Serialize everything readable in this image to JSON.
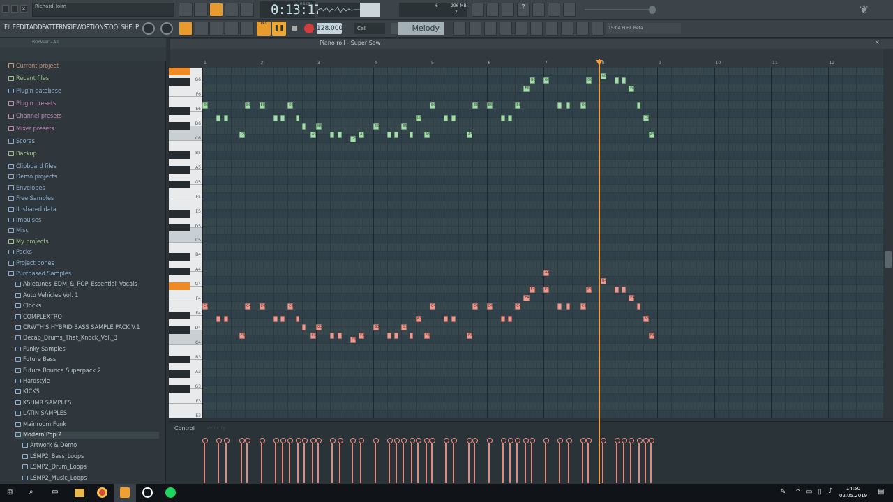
{
  "window": {
    "user": "RichardHolm"
  },
  "transport": {
    "time": "0:13:17",
    "time_label": "M:S:CS",
    "memory": "296 MB",
    "mem_small": "6",
    "voices": "2"
  },
  "menu": [
    "FILE",
    "EDIT",
    "ADD",
    "PATTERNS",
    "VIEW",
    "OPTIONS",
    "TOOLS",
    "HELP"
  ],
  "toolbar": {
    "tempo": "128.000",
    "snap": "Cell",
    "pattern": "Melody",
    "pat_label": "PAT",
    "hint_time": "15:04",
    "hint_text": "FLEX Beta"
  },
  "browser": {
    "header": "Browser - All",
    "items": [
      {
        "label": "Current project",
        "color": "#c69a7a",
        "indent": 0
      },
      {
        "label": "Recent files",
        "color": "#9fc38a",
        "indent": 0
      },
      {
        "label": "Plugin database",
        "color": "#8fb0d0",
        "indent": 0
      },
      {
        "label": "Plugin presets",
        "color": "#c08ab3",
        "indent": 0
      },
      {
        "label": "Channel presets",
        "color": "#c08ab3",
        "indent": 0
      },
      {
        "label": "Mixer presets",
        "color": "#c08ab3",
        "indent": 0
      },
      {
        "label": "Scores",
        "color": "#8fb0d0",
        "indent": 0
      },
      {
        "label": "Backup",
        "color": "#9fc38a",
        "indent": 0
      },
      {
        "label": "Clipboard files",
        "color": "#8fb0d0",
        "indent": 0
      },
      {
        "label": "Demo projects",
        "color": "#8fb0d0",
        "indent": 0
      },
      {
        "label": "Envelopes",
        "color": "#8fb0d0",
        "indent": 0
      },
      {
        "label": "Free Samples",
        "color": "#8fb0d0",
        "indent": 0
      },
      {
        "label": "IL shared data",
        "color": "#8fb0d0",
        "indent": 0
      },
      {
        "label": "Impulses",
        "color": "#8fb0d0",
        "indent": 0
      },
      {
        "label": "Misc",
        "color": "#8fb0d0",
        "indent": 0
      },
      {
        "label": "My projects",
        "color": "#9fc38a",
        "indent": 0
      },
      {
        "label": "Packs",
        "color": "#8fb0d0",
        "indent": 0
      },
      {
        "label": "Project bones",
        "color": "#8fb0d0",
        "indent": 0
      },
      {
        "label": "Purchased Samples",
        "color": "#8fb0d0",
        "indent": 0
      },
      {
        "label": "Abletunes_EDM_&_POP_Essential_Vocals",
        "color": "#8fb0d0",
        "indent": 1
      },
      {
        "label": "Auto Vehicles Vol. 1",
        "color": "#8fb0d0",
        "indent": 1
      },
      {
        "label": "Clocks",
        "color": "#8fb0d0",
        "indent": 1
      },
      {
        "label": "COMPLEXTRO",
        "color": "#8fb0d0",
        "indent": 1
      },
      {
        "label": "CRWTH'S HYBRID BASS SAMPLE PACK V.1",
        "color": "#8fb0d0",
        "indent": 1
      },
      {
        "label": "Decap_Drums_That_Knock_Vol._3",
        "color": "#8fb0d0",
        "indent": 1
      },
      {
        "label": "Funky Samples",
        "color": "#8fb0d0",
        "indent": 1
      },
      {
        "label": "Future Bass",
        "color": "#8fb0d0",
        "indent": 1
      },
      {
        "label": "Future Bounce Superpack 2",
        "color": "#8fb0d0",
        "indent": 1
      },
      {
        "label": "Hardstyle",
        "color": "#8fb0d0",
        "indent": 1
      },
      {
        "label": "KICKS",
        "color": "#8fb0d0",
        "indent": 1
      },
      {
        "label": "KSHMR SAMPLES",
        "color": "#8fb0d0",
        "indent": 1
      },
      {
        "label": "LATIN SAMPLES",
        "color": "#8fb0d0",
        "indent": 1
      },
      {
        "label": "Mainroom Funk",
        "color": "#8fb0d0",
        "indent": 1
      },
      {
        "label": "Modern Pop 2",
        "color": "#8fb0d0",
        "indent": 1
      },
      {
        "label": "Artwork & Demo",
        "color": "#8fb0d0",
        "indent": 2
      },
      {
        "label": "LSMP2_Bass_Loops",
        "color": "#8fb0d0",
        "indent": 2
      },
      {
        "label": "LSMP2_Drum_Loops",
        "color": "#8fb0d0",
        "indent": 2
      },
      {
        "label": "LSMP2_Music_Loops",
        "color": "#8fb0d0",
        "indent": 2
      }
    ]
  },
  "piano_roll": {
    "title": "Piano roll - Super Saw",
    "bars": [
      "1",
      "2",
      "3",
      "4",
      "5",
      "6",
      "7",
      "8",
      "9",
      "10",
      "11",
      "12"
    ],
    "key_labels": [
      "G6",
      "F6",
      "E6",
      "D6",
      "C6",
      "B5",
      "A5",
      "G5",
      "F5",
      "E5",
      "D5",
      "C5",
      "B4",
      "A4",
      "G4",
      "F4",
      "E4",
      "D4",
      "C4",
      "B3",
      "A3",
      "G3",
      "F3",
      "E3"
    ],
    "green_notes": [
      {
        "bar": 1.0,
        "row": 3,
        "len": 0.1,
        "label": "E6"
      },
      {
        "bar": 1.75,
        "row": 3,
        "len": 0.1,
        "label": "E6"
      },
      {
        "bar": 2.0,
        "row": 3,
        "len": 0.1,
        "label": "E6"
      },
      {
        "bar": 2.5,
        "row": 3,
        "len": 0.1,
        "label": "E6"
      },
      {
        "bar": 5.0,
        "row": 3,
        "len": 0.1,
        "label": "E6"
      },
      {
        "bar": 5.75,
        "row": 3,
        "len": 0.1,
        "label": "E6"
      },
      {
        "bar": 6.0,
        "row": 3,
        "len": 0.1,
        "label": "E6"
      },
      {
        "bar": 6.5,
        "row": 3,
        "len": 0.1,
        "label": "E6"
      },
      {
        "bar": 7.25,
        "row": 3,
        "len": 0.07
      },
      {
        "bar": 7.4,
        "row": 3,
        "len": 0.07
      },
      {
        "bar": 7.65,
        "row": 3,
        "len": 0.1,
        "label": "E6"
      },
      {
        "bar": 8.65,
        "row": 3,
        "len": 0.05
      },
      {
        "bar": 6.75,
        "row": 0,
        "len": 0.1,
        "label": "G6"
      },
      {
        "bar": 7.0,
        "row": 0,
        "len": 0.1,
        "label": "G6"
      },
      {
        "bar": 7.75,
        "row": 0,
        "len": 0.1,
        "label": "G6"
      },
      {
        "bar": 8.25,
        "row": 0,
        "len": 0.07
      },
      {
        "bar": 8.38,
        "row": 0,
        "len": 0.07
      },
      {
        "bar": 8.0,
        "row": -0.5,
        "len": 0.1,
        "label": "A6"
      },
      {
        "bar": 6.65,
        "row": 1,
        "len": 0.1,
        "label": "F6"
      },
      {
        "bar": 8.5,
        "row": 1,
        "len": 0.1,
        "label": "F6"
      },
      {
        "bar": 1.25,
        "row": 4.5,
        "len": 0.07
      },
      {
        "bar": 1.38,
        "row": 4.5,
        "len": 0.07
      },
      {
        "bar": 2.25,
        "row": 4.5,
        "len": 0.07
      },
      {
        "bar": 2.38,
        "row": 4.5,
        "len": 0.07
      },
      {
        "bar": 2.65,
        "row": 4.5,
        "len": 0.05
      },
      {
        "bar": 4.75,
        "row": 4.5,
        "len": 0.1,
        "label": "C6"
      },
      {
        "bar": 5.25,
        "row": 4.5,
        "len": 0.07
      },
      {
        "bar": 5.38,
        "row": 4.5,
        "len": 0.07
      },
      {
        "bar": 6.25,
        "row": 4.5,
        "len": 0.07
      },
      {
        "bar": 6.38,
        "row": 4.5,
        "len": 0.07
      },
      {
        "bar": 8.75,
        "row": 4.5,
        "len": 0.1,
        "label": "C6"
      },
      {
        "bar": 2.75,
        "row": 5.5,
        "len": 0.05
      },
      {
        "bar": 3.0,
        "row": 5.5,
        "len": 0.1,
        "label": "B5"
      },
      {
        "bar": 4.0,
        "row": 5.5,
        "len": 0.1,
        "label": "B5"
      },
      {
        "bar": 4.5,
        "row": 5.5,
        "len": 0.1,
        "label": "B5"
      },
      {
        "bar": 1.65,
        "row": 6.5,
        "len": 0.1,
        "label": "G5"
      },
      {
        "bar": 2.9,
        "row": 6.5,
        "len": 0.1,
        "label": "A5"
      },
      {
        "bar": 3.25,
        "row": 6.5,
        "len": 0.07
      },
      {
        "bar": 3.38,
        "row": 6.5,
        "len": 0.07
      },
      {
        "bar": 3.75,
        "row": 6.5,
        "len": 0.1,
        "label": "A5"
      },
      {
        "bar": 4.25,
        "row": 6.5,
        "len": 0.07
      },
      {
        "bar": 4.38,
        "row": 6.5,
        "len": 0.07
      },
      {
        "bar": 4.65,
        "row": 6.5,
        "len": 0.05
      },
      {
        "bar": 4.9,
        "row": 6.5,
        "len": 0.1,
        "label": "A5"
      },
      {
        "bar": 5.65,
        "row": 6.5,
        "len": 0.1,
        "label": "A5"
      },
      {
        "bar": 8.85,
        "row": 6.5,
        "len": 0.1,
        "label": "A5"
      },
      {
        "bar": 3.6,
        "row": 7,
        "len": 0.1,
        "label": "G5"
      }
    ],
    "red_notes": [
      {
        "bar": 7.0,
        "row": 0,
        "len": 0.1,
        "label": "A4"
      },
      {
        "bar": 8.0,
        "row": 1,
        "len": 0.1,
        "label": "G4"
      },
      {
        "bar": 6.75,
        "row": 2,
        "len": 0.1,
        "label": "F4"
      },
      {
        "bar": 7.0,
        "row": 2,
        "len": 0.1,
        "label": "F4"
      },
      {
        "bar": 7.75,
        "row": 2,
        "len": 0.1,
        "label": "F4"
      },
      {
        "bar": 8.25,
        "row": 2,
        "len": 0.07
      },
      {
        "bar": 8.38,
        "row": 2,
        "len": 0.07
      },
      {
        "bar": 6.65,
        "row": 3,
        "len": 0.1,
        "label": "E4"
      },
      {
        "bar": 8.5,
        "row": 3,
        "len": 0.1,
        "label": "E4"
      },
      {
        "bar": 1.0,
        "row": 4,
        "len": 0.1,
        "label": "C4"
      },
      {
        "bar": 1.75,
        "row": 4,
        "len": 0.1,
        "label": "C4"
      },
      {
        "bar": 2.0,
        "row": 4,
        "len": 0.1,
        "label": "C4"
      },
      {
        "bar": 2.5,
        "row": 4,
        "len": 0.1,
        "label": "C4"
      },
      {
        "bar": 5.0,
        "row": 4,
        "len": 0.1,
        "label": "C4"
      },
      {
        "bar": 5.75,
        "row": 4,
        "len": 0.1,
        "label": "C4"
      },
      {
        "bar": 6.0,
        "row": 4,
        "len": 0.1,
        "label": "C4"
      },
      {
        "bar": 6.5,
        "row": 4,
        "len": 0.1,
        "label": "C4"
      },
      {
        "bar": 7.25,
        "row": 4,
        "len": 0.07
      },
      {
        "bar": 7.4,
        "row": 4,
        "len": 0.07
      },
      {
        "bar": 7.65,
        "row": 4,
        "len": 0.1,
        "label": "C4"
      },
      {
        "bar": 8.65,
        "row": 4,
        "len": 0.05
      },
      {
        "bar": 1.25,
        "row": 5.5,
        "len": 0.07
      },
      {
        "bar": 1.38,
        "row": 5.5,
        "len": 0.07
      },
      {
        "bar": 2.25,
        "row": 5.5,
        "len": 0.07
      },
      {
        "bar": 2.38,
        "row": 5.5,
        "len": 0.07
      },
      {
        "bar": 2.65,
        "row": 5.5,
        "len": 0.05
      },
      {
        "bar": 4.75,
        "row": 5.5,
        "len": 0.1,
        "label": "A3"
      },
      {
        "bar": 5.25,
        "row": 5.5,
        "len": 0.07
      },
      {
        "bar": 5.38,
        "row": 5.5,
        "len": 0.07
      },
      {
        "bar": 6.25,
        "row": 5.5,
        "len": 0.07
      },
      {
        "bar": 6.38,
        "row": 5.5,
        "len": 0.07
      },
      {
        "bar": 8.75,
        "row": 5.5,
        "len": 0.1,
        "label": "A3"
      },
      {
        "bar": 2.75,
        "row": 6.5,
        "len": 0.05
      },
      {
        "bar": 3.0,
        "row": 6.5,
        "len": 0.1,
        "label": "G3"
      },
      {
        "bar": 4.0,
        "row": 6.5,
        "len": 0.1,
        "label": "G3"
      },
      {
        "bar": 4.5,
        "row": 6.5,
        "len": 0.1,
        "label": "G3"
      },
      {
        "bar": 1.65,
        "row": 7.5,
        "len": 0.1,
        "label": "F3"
      },
      {
        "bar": 2.9,
        "row": 7.5,
        "len": 0.1,
        "label": "F3"
      },
      {
        "bar": 3.25,
        "row": 7.5,
        "len": 0.07
      },
      {
        "bar": 3.38,
        "row": 7.5,
        "len": 0.07
      },
      {
        "bar": 3.75,
        "row": 7.5,
        "len": 0.1,
        "label": "F3"
      },
      {
        "bar": 4.25,
        "row": 7.5,
        "len": 0.07
      },
      {
        "bar": 4.38,
        "row": 7.5,
        "len": 0.07
      },
      {
        "bar": 4.65,
        "row": 7.5,
        "len": 0.05
      },
      {
        "bar": 4.9,
        "row": 7.5,
        "len": 0.1,
        "label": "F3"
      },
      {
        "bar": 5.65,
        "row": 7.5,
        "len": 0.1,
        "label": "F3"
      },
      {
        "bar": 8.85,
        "row": 7.5,
        "len": 0.1,
        "label": "F3"
      },
      {
        "bar": 3.6,
        "row": 8,
        "len": 0.1,
        "label": "E3"
      }
    ],
    "playhead_bar": 7.97,
    "control_label": "Control",
    "control_sub": "Velocity"
  },
  "taskbar": {
    "time": "14:50",
    "date": "02.05.2019"
  },
  "colors": {
    "accent": "#f08a24",
    "note_green": "#a6dcae",
    "note_red": "#e59d95",
    "playhead": "#f0a040"
  }
}
